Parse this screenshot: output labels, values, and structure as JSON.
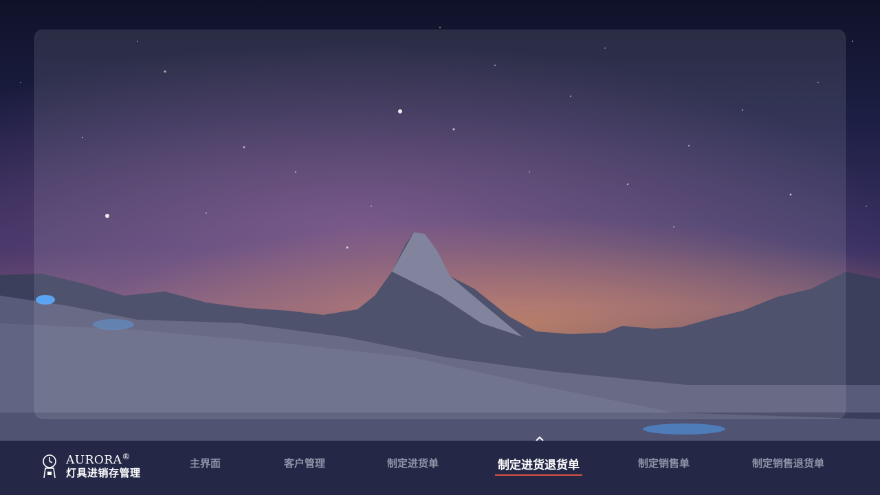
{
  "app": {
    "brand_name": "AURORA",
    "brand_mark": "®",
    "brand_subtitle": "灯具进销存管理",
    "logo_icon": "clock-lamp-icon"
  },
  "scroll_indicator": {
    "icon": "chevron-up-icon"
  },
  "nav": {
    "items": [
      {
        "label": "主界面",
        "active": false
      },
      {
        "label": "客户管理",
        "active": false
      },
      {
        "label": "制定进货单",
        "active": false
      },
      {
        "label": "制定进货退货单",
        "active": true
      },
      {
        "label": "制定销售单",
        "active": false
      },
      {
        "label": "制定销售退货单",
        "active": false
      }
    ],
    "active_underline_color": "#d9533f"
  },
  "colors": {
    "panel_overlay": "rgba(255,255,255,0.10)",
    "nav_background": "#141834",
    "nav_text": "#8f93a8",
    "nav_active_text": "#ffffff"
  }
}
